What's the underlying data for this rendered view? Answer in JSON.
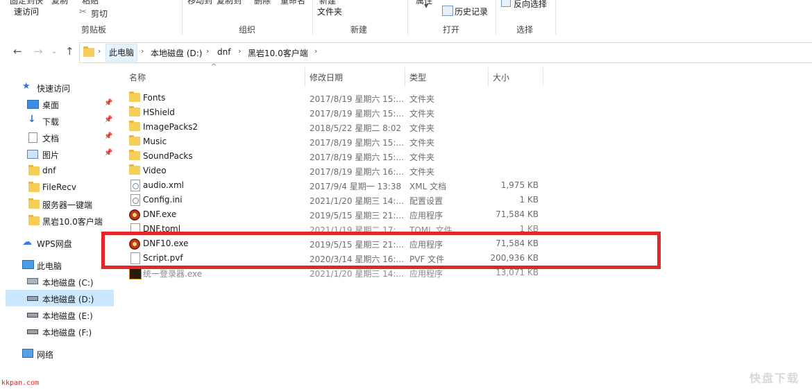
{
  "ribbon": {
    "quick_access_cut": "固定到快",
    "quick_access_line2": "速访问",
    "copy_cut": "复制",
    "paste_cut": "粘贴",
    "cut_label": "剪切",
    "clipboard_group": "剪贴板",
    "move_cut": "移动到",
    "copy_to_cut": "复制到",
    "delete_cut": "删除",
    "rename_cut": "重命名",
    "organize_group": "组织",
    "new_cut": "新建",
    "new_folder_line2": "文件夹",
    "new_group": "新建",
    "props_cut": "属性",
    "history_label": "历史记录",
    "open_group": "打开",
    "invert_label": "反向选择",
    "select_group": "选择"
  },
  "address": {
    "breadcrumbs": [
      "此电脑",
      "本地磁盘 (D:)",
      "dnf",
      "黑岩10.0客户端"
    ]
  },
  "sidebar": {
    "quick_access": "快速访问",
    "quick_items": [
      {
        "label": "桌面",
        "icon": "desktop-icon",
        "pinned": true
      },
      {
        "label": "下载",
        "icon": "download-icon",
        "pinned": true
      },
      {
        "label": "文档",
        "icon": "document-icon",
        "pinned": true
      },
      {
        "label": "图片",
        "icon": "picture-icon",
        "pinned": true
      },
      {
        "label": "dnf",
        "icon": "folder-icon",
        "pinned": false
      },
      {
        "label": "FileRecv",
        "icon": "folder-icon",
        "pinned": false
      },
      {
        "label": "服务器一键端",
        "icon": "folder-icon",
        "pinned": false
      },
      {
        "label": "黑岩10.0客户端",
        "icon": "folder-icon",
        "pinned": false
      }
    ],
    "wps": "WPS网盘",
    "this_pc": "此电脑",
    "drives": [
      "本地磁盘 (C:)",
      "本地磁盘 (D:)",
      "本地磁盘 (E:)",
      "本地磁盘 (F:)"
    ],
    "network": "网络"
  },
  "columns": {
    "name": "名称",
    "date": "修改日期",
    "type": "类型",
    "size": "大小"
  },
  "files": [
    {
      "name": "Fonts",
      "date": "2017/8/19 星期六 15:...",
      "type": "文件夹",
      "size": "",
      "icon": "folder"
    },
    {
      "name": "HShield",
      "date": "2017/8/19 星期六 15:...",
      "type": "文件夹",
      "size": "",
      "icon": "folder"
    },
    {
      "name": "ImagePacks2",
      "date": "2018/5/22 星期二 8:02",
      "type": "文件夹",
      "size": "",
      "icon": "folder"
    },
    {
      "name": "Music",
      "date": "2017/8/19 星期六 15:...",
      "type": "文件夹",
      "size": "",
      "icon": "folder"
    },
    {
      "name": "SoundPacks",
      "date": "2017/8/19 星期六 15:...",
      "type": "文件夹",
      "size": "",
      "icon": "folder"
    },
    {
      "name": "Video",
      "date": "2017/8/19 星期六 16:...",
      "type": "文件夹",
      "size": "",
      "icon": "folder"
    },
    {
      "name": "audio.xml",
      "date": "2017/9/4 星期一 13:38",
      "type": "XML 文档",
      "size": "1,975 KB",
      "icon": "xml"
    },
    {
      "name": "Config.ini",
      "date": "2021/1/20 星期三 14:...",
      "type": "配置设置",
      "size": "1 KB",
      "icon": "ini"
    },
    {
      "name": "DNF.exe",
      "date": "2019/5/15 星期三 21:...",
      "type": "应用程序",
      "size": "71,584 KB",
      "icon": "exe"
    },
    {
      "name": "DNF.toml",
      "date": "2021/1/19 星期二 17:...",
      "type": "TOML 文件",
      "size": "1 KB",
      "icon": "file"
    },
    {
      "name": "DNF10.exe",
      "date": "2019/5/15 星期三 21:...",
      "type": "应用程序",
      "size": "71,584 KB",
      "icon": "exe"
    },
    {
      "name": "Script.pvf",
      "date": "2020/3/14 星期六 16:...",
      "type": "PVF 文件",
      "size": "200,936 KB",
      "icon": "file"
    },
    {
      "name": "统一登录器.exe",
      "date": "2021/1/20 星期三 14:...",
      "type": "应用程序",
      "size": "13,071 KB",
      "icon": "exe2"
    }
  ],
  "watermark": {
    "left": "kkpan.com",
    "right": "快盘下载"
  },
  "colors": {
    "highlight": "#e3262a",
    "selection": "#cce8ff",
    "folder": "#f6cf5a"
  }
}
